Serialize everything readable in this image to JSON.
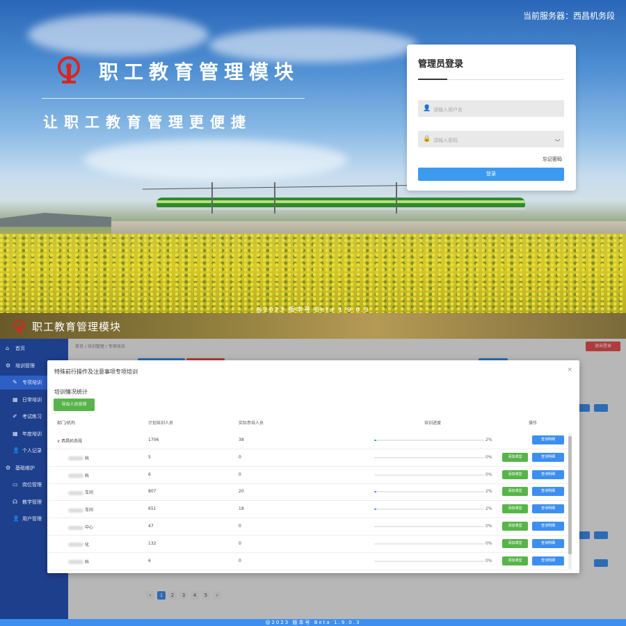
{
  "login": {
    "server_label": "当前服务器：西昌机务段",
    "brand_title": "职工教育管理模块",
    "slogan": "让职工教育管理更便捷",
    "card_title": "管理员登录",
    "username_placeholder": "请输入用户名",
    "password_placeholder": "请输入密码",
    "forgot": "忘记密码",
    "login_button": "登录",
    "footer": "@2023    版本号 Beta 1.9.0.3"
  },
  "admin": {
    "header_title": "职工教育管理模块",
    "breadcrumb": "首页 / 培训管理 / 专项培训",
    "logout": "退出登录",
    "sidebar": [
      {
        "icon": "home-icon",
        "glyph": "⌂",
        "label": "首页"
      },
      {
        "icon": "gear-icon",
        "glyph": "⚙",
        "label": "培训管理"
      },
      {
        "icon": "edit-icon",
        "glyph": "✎",
        "label": "专项培训",
        "active": true
      },
      {
        "icon": "calendar-icon",
        "glyph": "▦",
        "label": "日常培训"
      },
      {
        "icon": "pencil-icon",
        "glyph": "✐",
        "label": "考试练习"
      },
      {
        "icon": "calendar-icon",
        "glyph": "▦",
        "label": "年度培训"
      },
      {
        "icon": "user-icon",
        "glyph": "👤",
        "label": "个人记录"
      },
      {
        "icon": "gear-icon",
        "glyph": "⚙",
        "label": "基础维护"
      },
      {
        "icon": "folder-icon",
        "glyph": "▭",
        "label": "岗位管理"
      },
      {
        "icon": "headset-icon",
        "glyph": "☊",
        "label": "教学管理"
      },
      {
        "icon": "user-icon",
        "glyph": "👤",
        "label": "用户管理"
      }
    ],
    "pager": [
      "‹",
      "1",
      "2",
      "3",
      "4",
      "5",
      "›"
    ],
    "footer": "@2023    版本号 Beta 1.9.0.3"
  },
  "modal": {
    "title": "特殊前行操作及注意事项专项培训",
    "close": "×",
    "subtitle": "培训情况统计",
    "export_button": "导出人员安排",
    "columns": [
      "部门/机构",
      "计划培训人员",
      "实际参培人员",
      "培训进度",
      "操作"
    ],
    "rows": [
      {
        "dept": "∨ 西昌机务段",
        "planned": "1706",
        "actual": "38",
        "progress": 0.02,
        "pct": "2%",
        "add": "",
        "view": "查询明细"
      },
      {
        "dept": "科",
        "planned": "5",
        "actual": "0",
        "progress": 0,
        "pct": "0%",
        "add": "添加课堂",
        "view": "查询明细"
      },
      {
        "dept": "科",
        "planned": "6",
        "actual": "0",
        "progress": 0,
        "pct": "0%",
        "add": "添加课堂",
        "view": "查询明细"
      },
      {
        "dept": "车间",
        "planned": "807",
        "actual": "20",
        "progress": 0.02,
        "pct": "2%",
        "add": "添加课堂",
        "view": "查询明细"
      },
      {
        "dept": "车间",
        "planned": "651",
        "actual": "18",
        "progress": 0.02,
        "pct": "2%",
        "add": "添加课堂",
        "view": "查询明细"
      },
      {
        "dept": "中心",
        "planned": "47",
        "actual": "0",
        "progress": 0,
        "pct": "0%",
        "add": "添加课堂",
        "view": "查询明细"
      },
      {
        "dept": "化",
        "planned": "132",
        "actual": "0",
        "progress": 0,
        "pct": "0%",
        "add": "添加课堂",
        "view": "查询明细"
      },
      {
        "dept": "科",
        "planned": "6",
        "actual": "0",
        "progress": 0,
        "pct": "0%",
        "add": "添加课堂",
        "view": "查询明细"
      }
    ]
  },
  "colors": {
    "primary": "#3c8ff0",
    "success": "#58b44a",
    "danger": "#e85050",
    "sidebar": "#1e3f8c"
  }
}
